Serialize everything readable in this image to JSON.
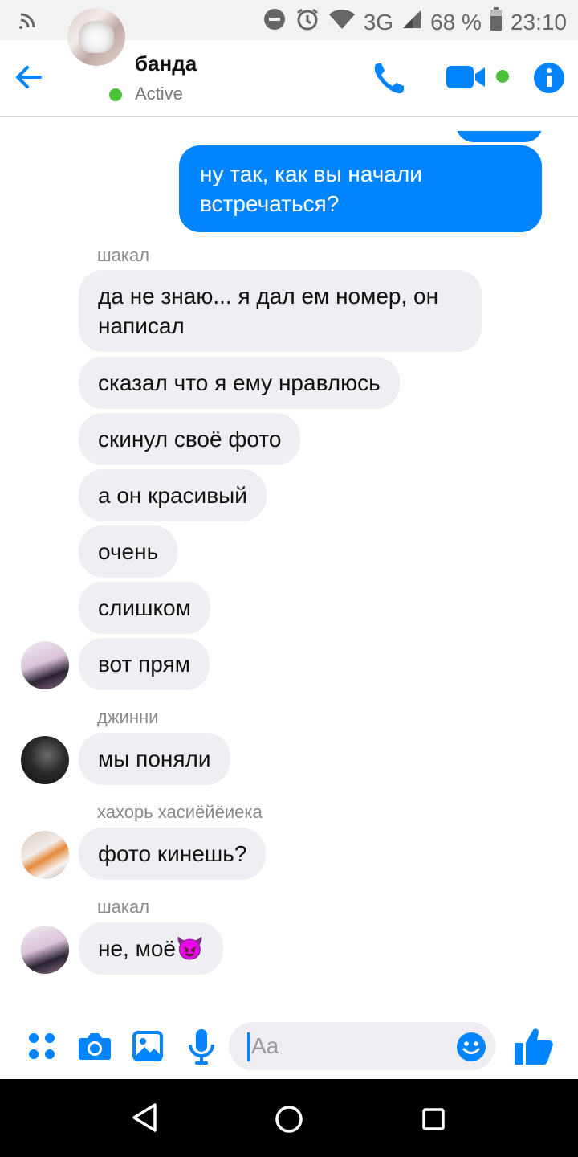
{
  "status_bar": {
    "network": "3G",
    "battery": "68 %",
    "time": "23:10",
    "icons": [
      "cast-icon",
      "do-not-disturb-icon",
      "alarm-icon",
      "wifi-icon",
      "signal-icon",
      "battery-icon"
    ]
  },
  "header": {
    "title": "банда",
    "status": "Active",
    "icons": [
      "back-arrow-icon",
      "phone-icon",
      "video-icon",
      "info-icon"
    ]
  },
  "colors": {
    "accent": "#0084ff",
    "online": "#4cc23a",
    "incoming_bubble": "#efeef3"
  },
  "messages": {
    "m0": "ну так, как вы начали встречаться?",
    "s1": "шакал",
    "m1": "да не знаю... я дал ем номер, он написал",
    "m2": "сказал что я ему нравлюсь",
    "m3": "скинул своё фото",
    "m4": "а он красивый",
    "m5": "очень",
    "m6": "слишком",
    "m7": "вот прям",
    "s2": "джинни",
    "m8": "мы поняли",
    "s3": "хахорь хасиёйёиека",
    "m9": "фото кинешь?",
    "s4": "шакал",
    "m10": "не, моё",
    "m10_emoji": "😈"
  },
  "composer": {
    "placeholder": "Aa",
    "icons": [
      "apps-icon",
      "camera-icon",
      "gallery-icon",
      "microphone-icon",
      "emoji-icon",
      "thumbs-up-icon"
    ]
  },
  "nav_bar": {
    "icons": [
      "back-triangle-icon",
      "home-circle-icon",
      "recents-square-icon"
    ]
  }
}
